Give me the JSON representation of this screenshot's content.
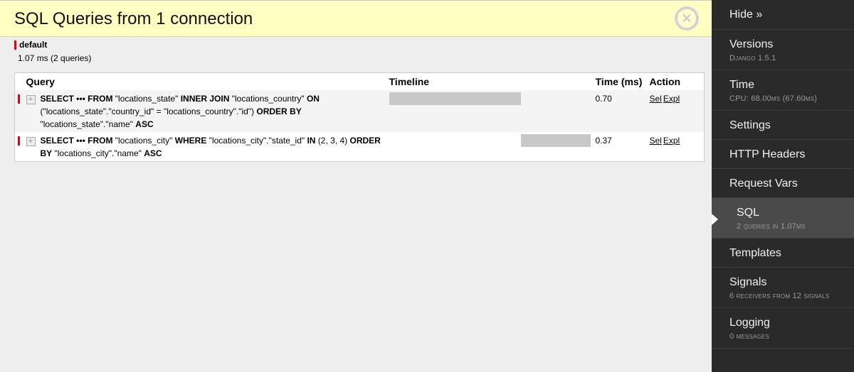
{
  "panel": {
    "title": "SQL Queries from 1 connection",
    "close_icon": "close-circle-icon"
  },
  "database": {
    "name": "default",
    "color": "#ee0000",
    "stats": "1.07 ms (2 queries)"
  },
  "table": {
    "headers": {
      "query": "Query",
      "timeline": "Timeline",
      "time": "Time (ms)",
      "action": "Action"
    },
    "rows": [
      {
        "toggle": "+",
        "query_parts": [
          {
            "t": "SELECT",
            "kw": true
          },
          {
            "t": " ••• ",
            "kw": true
          },
          {
            "t": "FROM",
            "kw": true
          },
          {
            "t": " \"locations_state\" ",
            "kw": false
          },
          {
            "t": "INNER JOIN",
            "kw": true
          },
          {
            "t": " \"locations_country\" ",
            "kw": false
          },
          {
            "t": "ON",
            "kw": true
          },
          {
            "t": " (\"locations_state\".\"country_id\" = \"locations_country\".\"id\") ",
            "kw": false
          },
          {
            "t": "ORDER BY",
            "kw": true
          },
          {
            "t": " \"locations_state\".\"name\" ",
            "kw": false
          },
          {
            "t": "ASC",
            "kw": true
          }
        ],
        "timeline_offset_pct": 0,
        "timeline_width_pct": 65.4,
        "time": "0.70",
        "actions": [
          "Sel",
          "Expl"
        ]
      },
      {
        "toggle": "+",
        "query_parts": [
          {
            "t": "SELECT",
            "kw": true
          },
          {
            "t": " ••• ",
            "kw": true
          },
          {
            "t": "FROM",
            "kw": true
          },
          {
            "t": " \"locations_city\" ",
            "kw": false
          },
          {
            "t": "WHERE",
            "kw": true
          },
          {
            "t": " \"locations_city\".\"state_id\" ",
            "kw": false
          },
          {
            "t": "IN",
            "kw": true
          },
          {
            "t": " (2, 3, 4) ",
            "kw": false
          },
          {
            "t": "ORDER BY",
            "kw": true
          },
          {
            "t": " \"locations_city\".\"name\" ",
            "kw": false
          },
          {
            "t": "ASC",
            "kw": true
          }
        ],
        "timeline_offset_pct": 65.4,
        "timeline_width_pct": 34.6,
        "time": "0.37",
        "actions": [
          "Sel",
          "Expl"
        ]
      }
    ]
  },
  "sidebar": {
    "hide_label": "Hide »",
    "items": [
      {
        "title": "Versions",
        "sub": "Django 1.5.1"
      },
      {
        "title": "Time",
        "sub": "CPU: 68.00ms (67.60ms)"
      },
      {
        "title": "Settings",
        "sub": ""
      },
      {
        "title": "HTTP Headers",
        "sub": ""
      },
      {
        "title": "Request Vars",
        "sub": ""
      },
      {
        "title": "SQL",
        "sub": "2 queries in 1.07ms",
        "active": true
      },
      {
        "title": "Templates",
        "sub": ""
      },
      {
        "title": "Signals",
        "sub": "6 receivers from 12 signals"
      },
      {
        "title": "Logging",
        "sub": "0 messages"
      }
    ]
  }
}
